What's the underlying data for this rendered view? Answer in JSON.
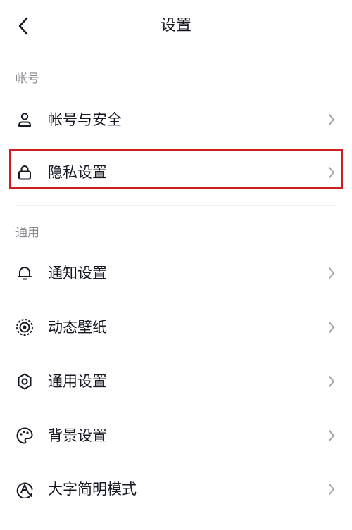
{
  "header": {
    "title": "设置",
    "back_icon": "chevron-left-icon"
  },
  "sections": [
    {
      "label": "帐号",
      "items": [
        {
          "label": "帐号与安全",
          "icon": "user-icon"
        },
        {
          "label": "隐私设置",
          "icon": "lock-icon",
          "highlighted": true
        }
      ]
    },
    {
      "label": "通用",
      "items": [
        {
          "label": "通知设置",
          "icon": "bell-icon"
        },
        {
          "label": "动态壁纸",
          "icon": "live-wallpaper-icon"
        },
        {
          "label": "通用设置",
          "icon": "gear-icon"
        },
        {
          "label": "背景设置",
          "icon": "palette-icon"
        },
        {
          "label": "大字简明模式",
          "icon": "large-font-icon"
        }
      ]
    }
  ],
  "colors": {
    "highlight": "#c8211f",
    "text": "#161823",
    "secondary_text": "#8a8b91",
    "chevron": "#a0a1a6"
  }
}
